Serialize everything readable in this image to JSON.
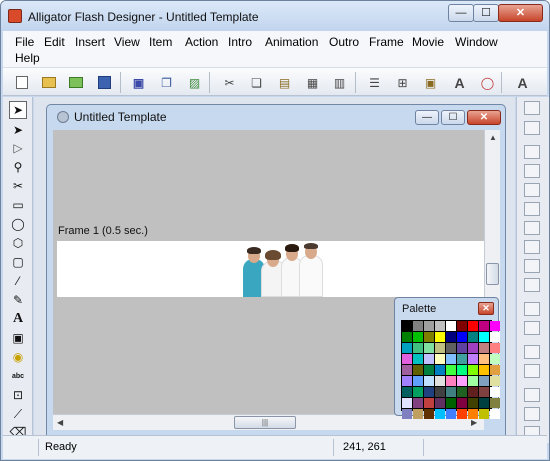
{
  "window": {
    "title": "Alligator Flash Designer - Untitled Template",
    "min_label": "—",
    "max_label": "☐",
    "close_label": "✕"
  },
  "menu": [
    "File",
    "Edit",
    "Insert",
    "View",
    "Item",
    "Action",
    "Intro",
    "Animation",
    "Outro",
    "Frame",
    "Movie",
    "Window",
    "Help"
  ],
  "child_window": {
    "title": "Untitled Template",
    "min_label": "—",
    "max_label": "☐",
    "close_label": "✕"
  },
  "canvas": {
    "frame_label": "Frame 1 (0.5 sec.)"
  },
  "scroll": {
    "grip": "|||"
  },
  "palette": {
    "title": "Palette",
    "close_label": "✕",
    "colors": [
      "#000000",
      "#808080",
      "#a0a0a0",
      "#c0c0c0",
      "#ffffff",
      "#800000",
      "#ff0000",
      "#c00080",
      "#ff00ff",
      "#008000",
      "#00c000",
      "#808000",
      "#ffff00",
      "#000080",
      "#0000ff",
      "#008080",
      "#00ffff",
      "#ffffff",
      "#00a0c0",
      "#40c080",
      "#80e0a0",
      "#c0c080",
      "#606060",
      "#6040a0",
      "#a040c0",
      "#c08080",
      "#ff8080",
      "#e060e0",
      "#00c0c0",
      "#c0c0ff",
      "#ffffc0",
      "#80c0ff",
      "#40a0a0",
      "#c080ff",
      "#ffc080",
      "#c0ffc0",
      "#a060a0",
      "#606000",
      "#008040",
      "#0080c0",
      "#40ff40",
      "#00ff80",
      "#80ff00",
      "#ffc000",
      "#e0a040",
      "#a080ff",
      "#60a0ff",
      "#c0e0ff",
      "#e0e0e0",
      "#ff80c0",
      "#ffa0ff",
      "#a0ffa0",
      "#80a0c0",
      "#e0e0a0",
      "#006060",
      "#00a060",
      "#204080",
      "#404040",
      "#408080",
      "#206020",
      "#602020",
      "#804040",
      "#ffffff",
      "#e0e0ff",
      "#804080",
      "#c04040",
      "#603060",
      "#006000",
      "#800040",
      "#404000",
      "#004040",
      "#808040",
      "#8080c0",
      "#c0a060",
      "#603000",
      "#00c0ff",
      "#4080ff",
      "#ff4000",
      "#ff8000",
      "#c0c000",
      "#ffffff"
    ]
  },
  "status": {
    "text": "Ready",
    "coords": "241, 261"
  }
}
